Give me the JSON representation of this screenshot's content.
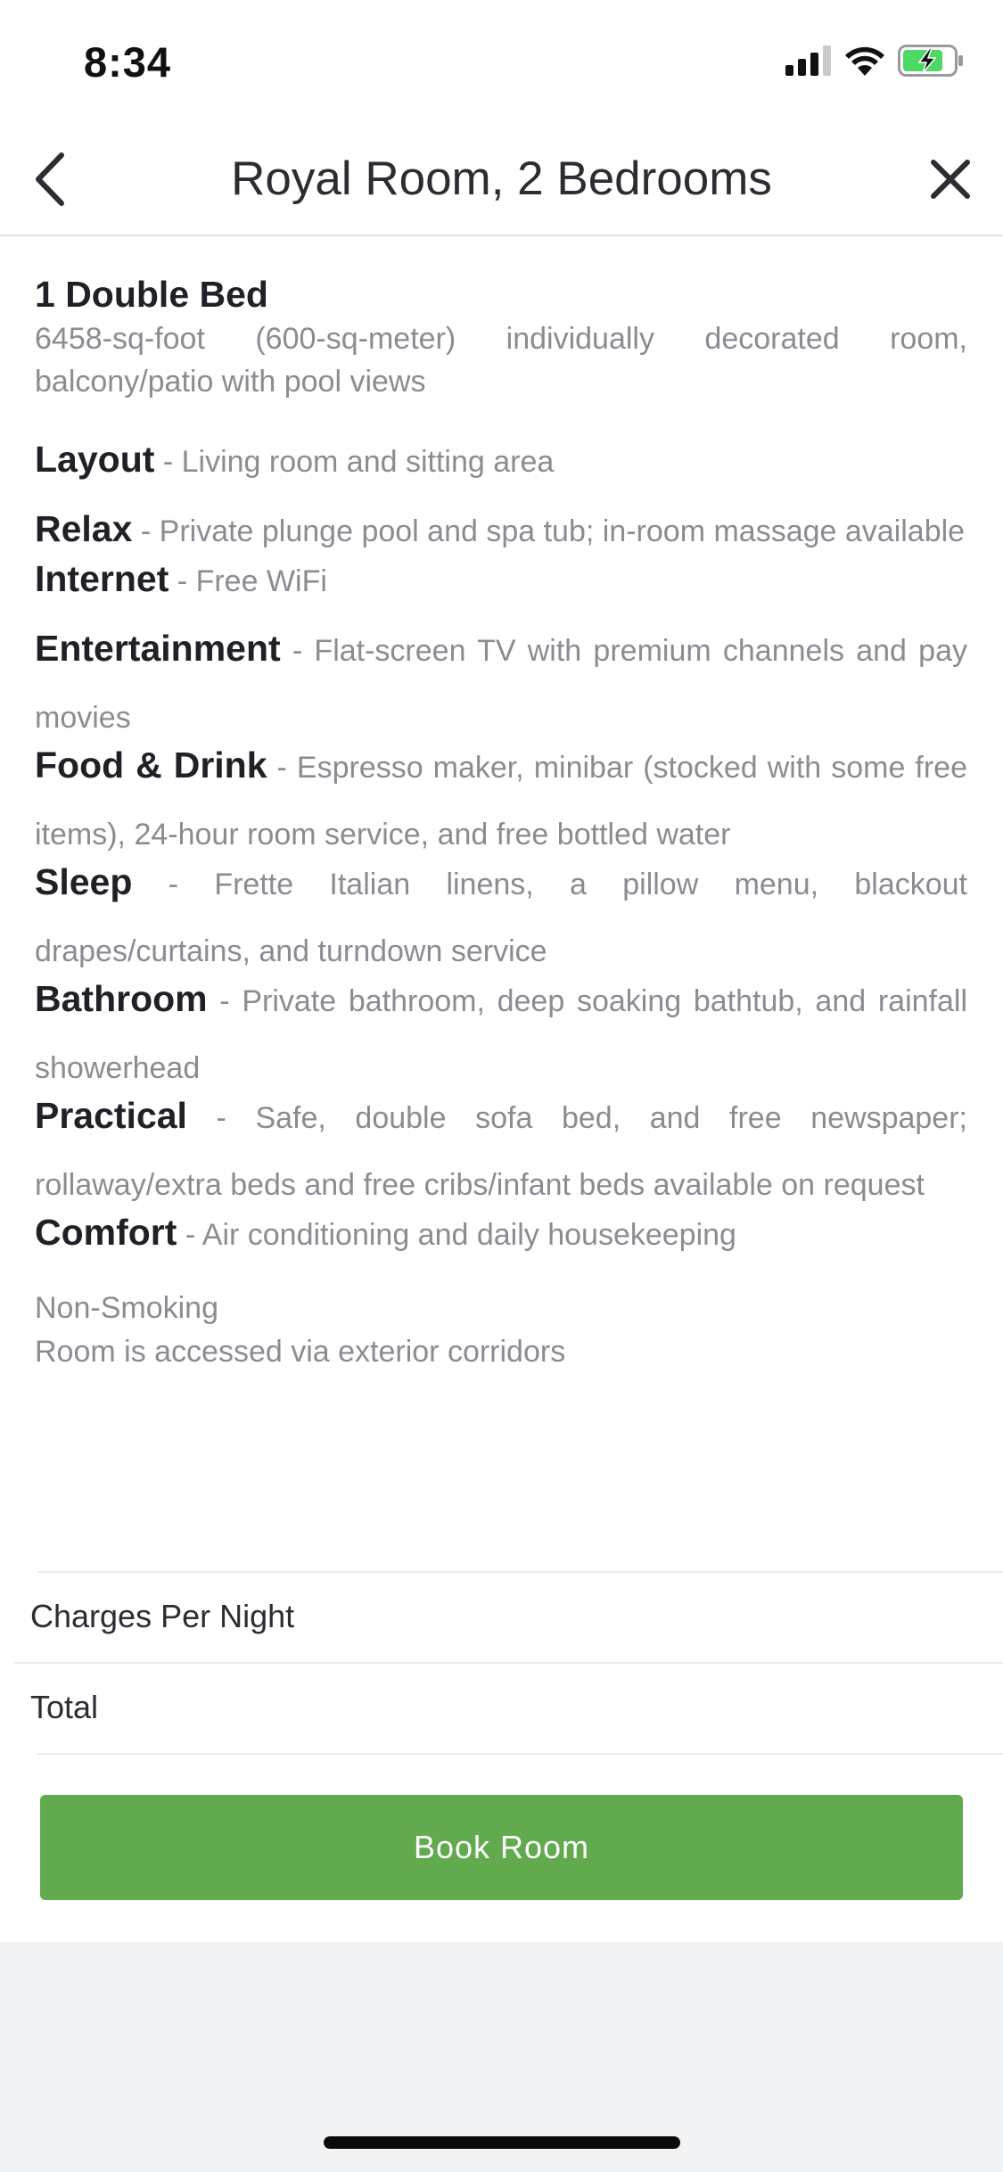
{
  "status_bar": {
    "time": "8:34",
    "icons": [
      "signal-icon",
      "wifi-icon",
      "battery-charging-icon"
    ]
  },
  "nav": {
    "title": "Royal Room, 2 Bedrooms",
    "back_icon": "chevron-left-icon",
    "close_icon": "close-icon"
  },
  "room": {
    "bed_title": "1 Double Bed",
    "bed_description": "6458-sq-foot (600-sq-meter) individually decorated room, balcony/patio with pool views",
    "features": [
      {
        "label": "Layout",
        "text": " - Living room and sitting area"
      },
      {
        "label": "Relax",
        "text": " - Private plunge pool and spa tub; in-room massage available"
      },
      {
        "label": "Internet",
        "text": " - Free WiFi"
      },
      {
        "label": "Entertainment",
        "text": " - Flat-screen TV with premium channels and pay movies"
      },
      {
        "label": "Food & Drink",
        "text": " - Espresso maker, minibar (stocked with some free items), 24-hour room service, and free bottled water"
      },
      {
        "label": "Sleep",
        "text": " - Frette Italian linens, a pillow menu, blackout drapes/curtains, and turndown service"
      },
      {
        "label": "Bathroom",
        "text": " - Private bathroom, deep soaking bathtub, and rainfall showerhead"
      },
      {
        "label": "Practical",
        "text": " - Safe, double sofa bed, and free newspaper; rollaway/extra beds and free cribs/infant beds available on request"
      },
      {
        "label": "Comfort",
        "text": " - Air conditioning and daily housekeeping"
      }
    ],
    "smoking": "Non-Smoking",
    "access": "Room is accessed via exterior corridors"
  },
  "pricing": {
    "charges_label": "Charges Per Night",
    "total_label": "Total"
  },
  "actions": {
    "book_label": "Book Room"
  },
  "colors": {
    "accent_green": "#62aa4e",
    "title_text": "#2b2d33",
    "body_text": "#8a8c92",
    "background": "#f2f3f5"
  }
}
